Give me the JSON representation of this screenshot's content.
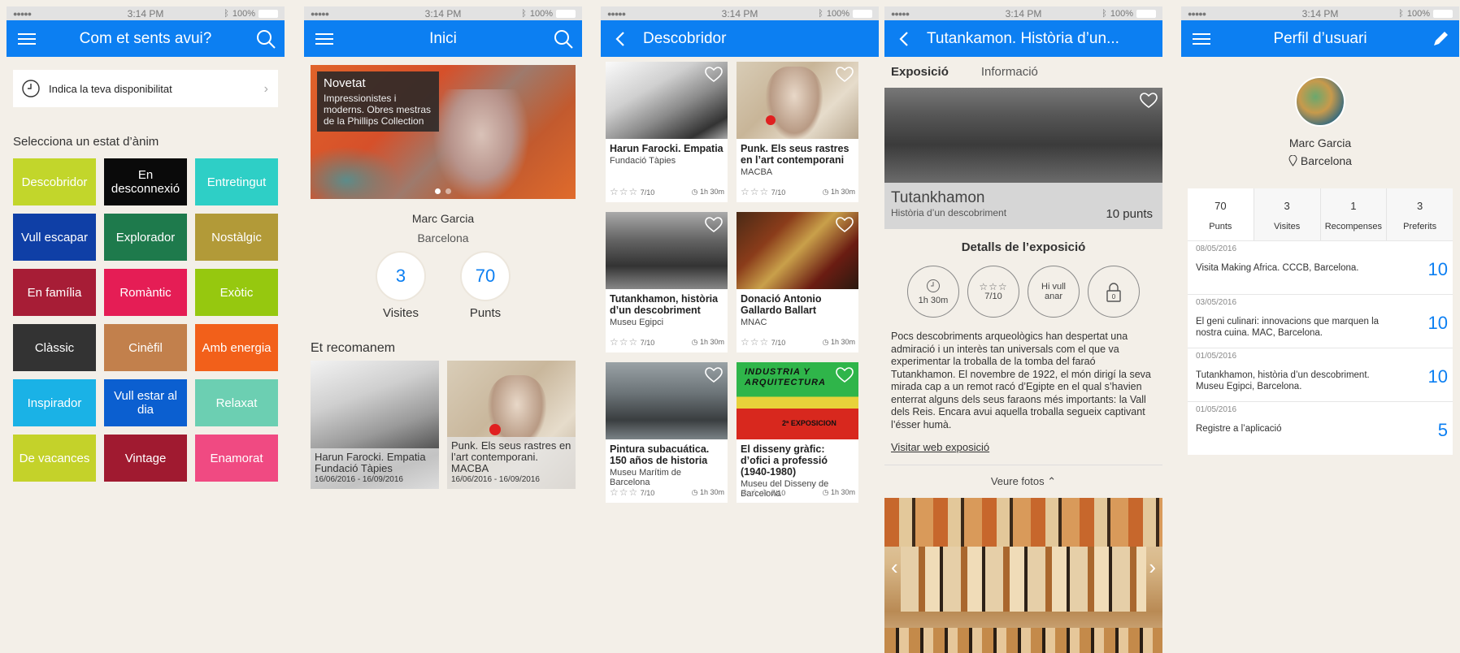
{
  "status": {
    "time": "3:14 PM",
    "battery": "100%"
  },
  "screen1": {
    "title": "Com et sents avui?",
    "availability": "Indica la teva disponibilitat",
    "section": "Selecciona un estat d’ànim",
    "moods": [
      {
        "label": "Descobridor",
        "color": "#c2d62b"
      },
      {
        "label": "En desconnexió",
        "color": "#0a0a0a"
      },
      {
        "label": "Entretingut",
        "color": "#2ecfc6"
      },
      {
        "label": "Vull escapar",
        "color": "#0f3fa6"
      },
      {
        "label": "Explorador",
        "color": "#1e7a4c"
      },
      {
        "label": "Nostàlgic",
        "color": "#b29a38"
      },
      {
        "label": "En família",
        "color": "#a71d36"
      },
      {
        "label": "Romàntic",
        "color": "#e51d55"
      },
      {
        "label": "Exòtic",
        "color": "#96c80f"
      },
      {
        "label": "Clàssic",
        "color": "#333333"
      },
      {
        "label": "Cinèfil",
        "color": "#c2804c"
      },
      {
        "label": "Amb energia",
        "color": "#f2601a"
      },
      {
        "label": "Inspirador",
        "color": "#1ab2e6"
      },
      {
        "label": "Vull estar al dia",
        "color": "#0b5fd0"
      },
      {
        "label": "Relaxat",
        "color": "#6ccfb2"
      },
      {
        "label": "De vacances",
        "color": "#c4d22a"
      },
      {
        "label": "Vintage",
        "color": "#a01a30"
      },
      {
        "label": "Enamorat",
        "color": "#f04a82"
      }
    ]
  },
  "screen2": {
    "title": "Inici",
    "hero": {
      "heading": "Novetat",
      "text": "Impressionistes i moderns. Obres mestras de la Phillips Collection"
    },
    "name": "Marc Garcia",
    "city": "Barcelona",
    "visits": {
      "value": "3",
      "label": "Visites"
    },
    "points": {
      "value": "70",
      "label": "Punts"
    },
    "recommend": "Et recomanem",
    "recs": [
      {
        "title": "Harun Farocki. Empatia",
        "place": "Fundació Tàpies",
        "date": "16/06/2016 - 16/09/2016"
      },
      {
        "title": "Punk. Els seus rastres en l’art contemporani.",
        "place": "MACBA",
        "date": "16/06/2016 - 16/09/2016"
      }
    ]
  },
  "screen3": {
    "title": "Descobridor",
    "cards": [
      {
        "title": "Harun Farocki. Empatia",
        "place": "Fundació Tàpies",
        "rating": "7/10",
        "time": "1h 30m"
      },
      {
        "title": "Punk. Els seus rastres en l’art contemporani",
        "place": "MACBA",
        "rating": "7/10",
        "time": "1h 30m"
      },
      {
        "title": "Tutankhamon, història d’un descobriment",
        "place": "Museu Egipci",
        "rating": "7/10",
        "time": "1h 30m"
      },
      {
        "title": "Donació Antonio Gallardo Ballart",
        "place": "MNAC",
        "rating": "7/10",
        "time": "1h 30m"
      },
      {
        "title": "Pintura subacuática. 150 años de historia",
        "place": "Museu Marítim de Barcelona",
        "rating": "7/10",
        "time": "1h 30m"
      },
      {
        "title": "El disseny gràfic: d’ofici a professió (1940-1980)",
        "place": "Museu del Disseny de Barcelona",
        "rating": "7/10",
        "time": "1h 30m"
      }
    ],
    "poster_text": "INDUSTRIA Y ARQUITECTURA",
    "poster_text2": "2ª EXPOSICION"
  },
  "screen4": {
    "title": "Tutankamon. Història d’un...",
    "tabs": [
      "Exposició",
      "Informació"
    ],
    "name": "Tutankhamon",
    "subtitle": "Història d’un descobriment",
    "points": "10 punts",
    "details": "Detalls de l’exposició",
    "duration": "1h 30m",
    "rating": "7/10",
    "want": "Hi vull anar",
    "lock_num": "0",
    "description": "Pocs descobriments arqueològics han despertat una admiració i un interès tan universals com el que va experimentar la troballa de la tomba del faraó Tutankhamon. El novembre de 1922, el món dirigí la seva mirada cap a un remot racó d’Egipte en el qual s’havien enterrat alguns dels seus faraons més importants: la Vall dels Reis. Encara avui aquella troballa segueix captivant l’ésser humà.",
    "link": "Visitar web exposició",
    "photos": "Veure fotos"
  },
  "screen5": {
    "title": "Perfil d’usuari",
    "name": "Marc Garcia",
    "city": "Barcelona",
    "tabs": [
      {
        "value": "70",
        "label": "Punts"
      },
      {
        "value": "3",
        "label": "Visites"
      },
      {
        "value": "1",
        "label": "Recompenses"
      },
      {
        "value": "3",
        "label": "Preferits"
      }
    ],
    "activity": [
      {
        "date": "08/05/2016",
        "text": "Visita Making Africa. CCCB, Barcelona.",
        "points": "10"
      },
      {
        "date": "03/05/2016",
        "text": "El geni culinari: innovacions que marquen la nostra cuina. MAC, Barcelona.",
        "points": "10"
      },
      {
        "date": "01/05/2016",
        "text": "Tutankhamon, història d’un descobriment. Museu Egipci, Barcelona.",
        "points": "10"
      },
      {
        "date": "01/05/2016",
        "text": "Registre a l’aplicació",
        "points": "5"
      }
    ]
  }
}
